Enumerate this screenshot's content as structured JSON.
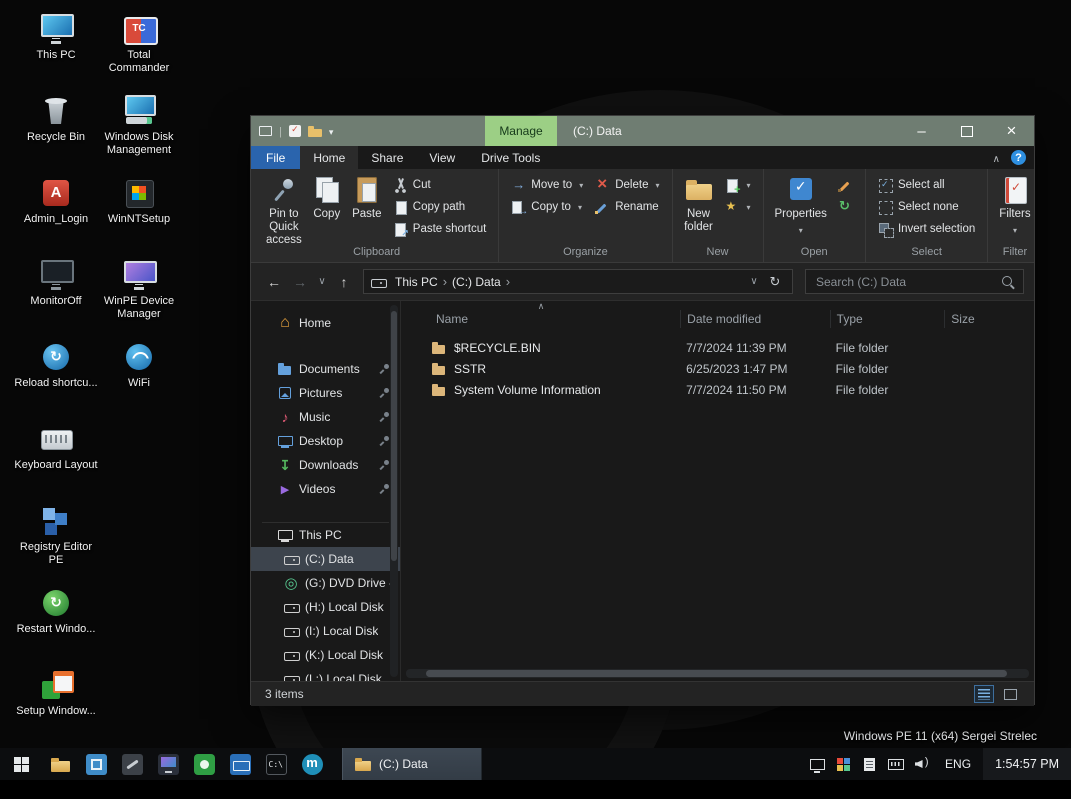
{
  "colors": {
    "titlebar": "#6f7d72",
    "manage_tab_bg": "#9ccf85",
    "file_tab_bg": "#2a64ad",
    "folder_icon": "#dcb67a",
    "nav_selection_bg": "#3d444d"
  },
  "desktop": {
    "column1": [
      {
        "label": "This PC",
        "icon": "ic-mon",
        "name": "desktop-icon-this-pc"
      },
      {
        "label": "Recycle Bin",
        "icon": "ic-bin",
        "name": "desktop-icon-recycle-bin"
      },
      {
        "label": "Admin_Login",
        "icon": "ic-admin",
        "name": "desktop-icon-admin-login"
      },
      {
        "label": "MonitorOff",
        "icon": "ic-monoff",
        "name": "desktop-icon-monitor-off"
      },
      {
        "label": "Reload shortcu...",
        "icon": "ic-reload",
        "name": "desktop-icon-reload-shortcuts"
      },
      {
        "label": "Keyboard Layout",
        "icon": "ic-kbd",
        "name": "desktop-icon-keyboard-layout"
      },
      {
        "label": "Registry Editor PE",
        "icon": "ic-reg",
        "name": "desktop-icon-registry-editor-pe"
      },
      {
        "label": "Restart Windo...",
        "icon": "ic-restart",
        "name": "desktop-icon-restart-windows"
      },
      {
        "label": "Setup Window...",
        "icon": "ic-setup",
        "name": "desktop-icon-setup-windows"
      }
    ],
    "column2": [
      {
        "label": "Total Commander",
        "icon": "ic-tc",
        "name": "desktop-icon-total-commander"
      },
      {
        "label": "Windows Disk Management",
        "icon": "ic-diskmgmt",
        "name": "desktop-icon-windows-disk-management"
      },
      {
        "label": "WinNTSetup",
        "icon": "ic-winnt",
        "name": "desktop-icon-winntsetup"
      },
      {
        "label": "WinPE Device Manager",
        "icon": "ic-devmgr",
        "name": "desktop-icon-winpe-device-manager"
      },
      {
        "label": "WiFi",
        "icon": "ic-wifi",
        "name": "desktop-icon-wifi"
      }
    ]
  },
  "overlay_label": "Windows PE 11 (x64) Sergei Strelec",
  "window": {
    "title": "(C:) Data",
    "manage_label": "Manage",
    "tabs": {
      "file": "File",
      "home": "Home",
      "share": "Share",
      "view": "View",
      "drive_tools": "Drive Tools"
    },
    "ribbon": {
      "pin_to_quick_access": "Pin to Quick access",
      "copy": "Copy",
      "paste": "Paste",
      "cut": "Cut",
      "copy_path": "Copy path",
      "paste_shortcut": "Paste shortcut",
      "move_to": "Move to",
      "copy_to": "Copy to",
      "delete_label": "Delete",
      "rename": "Rename",
      "new_folder": "New folder",
      "properties": "Properties",
      "select_all": "Select all",
      "select_none": "Select none",
      "invert_selection": "Invert selection",
      "filters": "Filters",
      "groups": {
        "clipboard": "Clipboard",
        "organize": "Organize",
        "new": "New",
        "open": "Open",
        "select": "Select",
        "filter": "Filter"
      }
    },
    "address": {
      "crumbs": [
        "This PC",
        "(C:) Data"
      ],
      "search_placeholder": "Search (C:) Data"
    },
    "columns": {
      "name": "Name",
      "date": "Date modified",
      "type": "Type",
      "size": "Size"
    },
    "sort": {
      "column": "Name",
      "direction": "ascending"
    },
    "nav": [
      {
        "label": "Home",
        "icon": "g-home",
        "color": "#e8a33d",
        "state": ""
      },
      {
        "label": "Documents",
        "icon": "g-folder",
        "color": "#64a0dc",
        "state": "pinned gap2"
      },
      {
        "label": "Pictures",
        "icon": "g-pic",
        "color": "#64a0dc",
        "state": "pinned"
      },
      {
        "label": "Music",
        "icon": "g-music",
        "color": "#e05a75",
        "state": "pinned"
      },
      {
        "label": "Desktop",
        "icon": "g-mon",
        "color": "#64a0dc",
        "state": "pinned"
      },
      {
        "label": "Downloads",
        "icon": "g-dl",
        "color": "#55b85f",
        "state": "pinned"
      },
      {
        "label": "Videos",
        "icon": "g-vid",
        "color": "#9a6ae0",
        "state": "pinned"
      },
      {
        "label": "This PC",
        "icon": "g-mon",
        "color": "#d8d8d8",
        "state": "gap2 line"
      },
      {
        "label": "(C:) Data",
        "icon": "g-drive",
        "color": "#d0d0d0",
        "state": "selected child"
      },
      {
        "label": "(G:) DVD Drive -",
        "icon": "g-disc",
        "color": "#57c78f",
        "state": "child"
      },
      {
        "label": "(H:) Local Disk",
        "icon": "g-drive",
        "color": "#d0d0d0",
        "state": "child"
      },
      {
        "label": "(I:) Local Disk",
        "icon": "g-drive",
        "color": "#d0d0d0",
        "state": "child"
      },
      {
        "label": "(K:) Local Disk",
        "icon": "g-drive",
        "color": "#d0d0d0",
        "state": "child"
      },
      {
        "label": "(L:) Local Disk",
        "icon": "g-drive",
        "color": "#d0d0d0",
        "state": "child"
      }
    ],
    "files": [
      {
        "name": "$RECYCLE.BIN",
        "date_modified": "7/7/2024 11:39 PM",
        "type": "File folder",
        "size": ""
      },
      {
        "name": "SSTR",
        "date_modified": "6/25/2023 1:47 PM",
        "type": "File folder",
        "size": ""
      },
      {
        "name": "System Volume Information",
        "date_modified": "7/7/2024 11:50 PM",
        "type": "File folder",
        "size": ""
      }
    ],
    "status": {
      "items_count": "3 items"
    }
  },
  "taskbar": {
    "task_label": "(C:) Data",
    "lang": "ENG",
    "time": "1:54:57 PM",
    "apps": [
      {
        "name": "taskbar-icon-explorer",
        "icon": "tb-explorer"
      },
      {
        "name": "taskbar-icon-blue-app",
        "icon": "tb-blue"
      },
      {
        "name": "taskbar-icon-tools-app",
        "icon": "tb-dark"
      },
      {
        "name": "taskbar-icon-display-app",
        "icon": "tb-display"
      },
      {
        "name": "taskbar-icon-green-app",
        "icon": "tb-green"
      },
      {
        "name": "taskbar-icon-keyboard-app",
        "icon": "tb-blue2"
      },
      {
        "name": "taskbar-icon-cmd",
        "icon": "tb-cmd"
      },
      {
        "name": "taskbar-icon-teal-app",
        "icon": "tb-teal"
      }
    ],
    "tray": [
      {
        "name": "tray-display-icon",
        "icon": "tr-disp"
      },
      {
        "name": "tray-colors-icon",
        "icon": "tr-colors"
      },
      {
        "name": "tray-notes-icon",
        "icon": "tr-notes"
      },
      {
        "name": "tray-keyboard-icon",
        "icon": "tr-kbd"
      },
      {
        "name": "tray-volume-icon",
        "icon": "tr-vol"
      }
    ]
  }
}
